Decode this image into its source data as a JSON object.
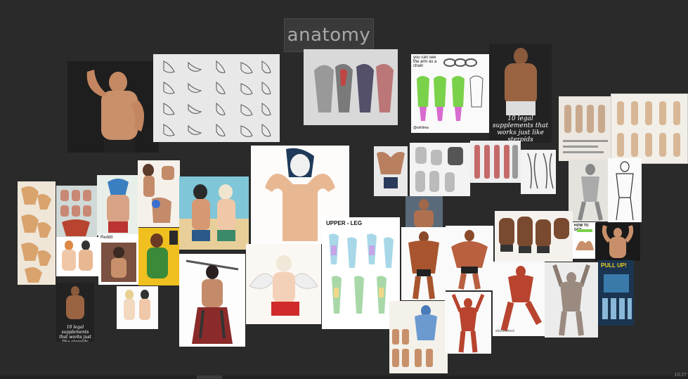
{
  "board": {
    "title": "anatomy",
    "background": "#2a2a2a"
  },
  "cards": {
    "flex_man_caption": "",
    "supplements_top_caption": "10 legal supplements that works just like steroids",
    "arm_chain_note": "you can see the arm as a chain",
    "arm_chain_credit": "@whilirea",
    "upper_leg_title": "UPPER - LEG",
    "supplements_bottom_caption": "10 legal supplements that works just like steroids",
    "pullup_title": "PULL UP!",
    "how_to_get_title": "HOW TO GET",
    "reddit_title": "Reddit",
    "shutterstock_label": "shutterstock"
  },
  "colors": {
    "accent_green": "#7ad14a",
    "accent_pink": "#d86ad0",
    "skin": "#c8906a",
    "muscle_red": "#b8442f",
    "pale_paper": "#f2efe8"
  },
  "taskbar": {
    "clock": "10:27"
  }
}
